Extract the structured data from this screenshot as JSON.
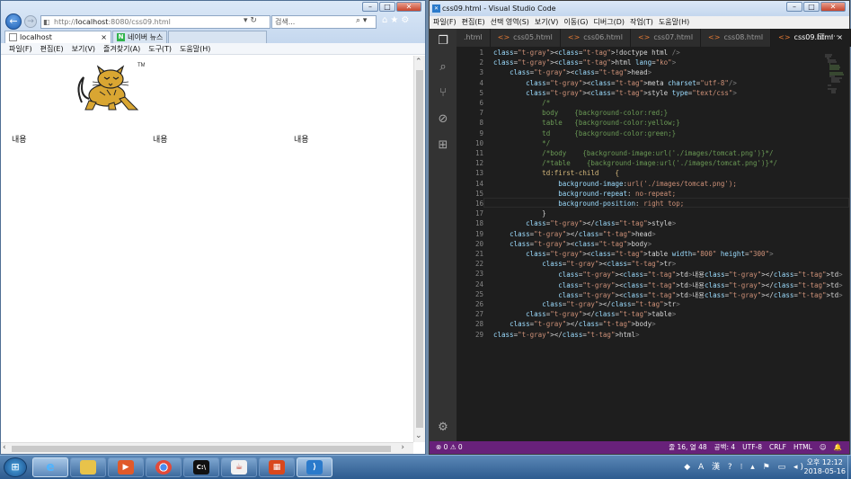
{
  "ie": {
    "address_prefix": "http://",
    "address_host": "localhost",
    "address_rest": ":8080/css09.html",
    "address_tools": "▾ ↻",
    "search_placeholder": "검색...",
    "tabs": [
      {
        "label": "localhost",
        "close": "×",
        "active": true
      },
      {
        "label": "네이버 뉴스",
        "fav": "N",
        "active": false
      }
    ],
    "menu": [
      "파일(F)",
      "편집(E)",
      "보기(V)",
      "즐겨찾기(A)",
      "도구(T)",
      "도움말(H)"
    ],
    "cells": [
      "내용",
      "내용",
      "내용"
    ],
    "logo_tm": "TM"
  },
  "vscode": {
    "title": "css09.html - Visual Studio Code",
    "menu": [
      "파일(F)",
      "편집(E)",
      "선택 영역(S)",
      "보기(V)",
      "이동(G)",
      "디버그(D)",
      "작업(T)",
      "도움말(H)"
    ],
    "tabs": [
      {
        "label": ".html",
        "dirty": false,
        "active": false
      },
      {
        "label": "css05.html",
        "dirty": true,
        "active": false
      },
      {
        "label": "css06.html",
        "dirty": true,
        "active": false
      },
      {
        "label": "css07.html",
        "dirty": true,
        "active": false
      },
      {
        "label": "css08.html",
        "dirty": true,
        "active": false
      },
      {
        "label": "css09.html",
        "dirty": true,
        "active": true
      }
    ],
    "code_lines": [
      "<!doctype html />",
      "<html lang=\"ko\">",
      "    <head>",
      "        <meta charset=\"utf-8\"/>",
      "        <style type=\"text/css\">",
      "            /*",
      "            body    {background-color:red;}",
      "            table   {background-color:yellow;}",
      "            td      {background-color:green;}",
      "            */",
      "            /*body    {background-image:url('./images/tomcat.png')}*/",
      "            /*table    {background-image:url('./images/tomcat.png')}*/",
      "            td:first-child    {",
      "                background-image:url('./images/tomcat.png');",
      "                background-repeat: no-repeat;",
      "                background-position: right top;",
      "            }",
      "        </style>",
      "    </head>",
      "    <body>",
      "        <table width=\"800\" height=\"300\">",
      "            <tr>",
      "                <td>내용</td>",
      "                <td>내용</td>",
      "                <td>내용</td>",
      "            </tr>",
      "        </table>",
      "    </body>",
      "</html>"
    ],
    "status_left": "⊗ 0 ⚠ 0",
    "status_right": [
      "줄 16, 열 48",
      "공백: 4",
      "UTF-8",
      "CRLF",
      "HTML",
      "☺",
      "🔔"
    ]
  },
  "taskbar": {
    "time": "오후 12:12",
    "date": "2018-05-16",
    "tray": "◆ A 漢 ? ⁝ ▴ ⚑ ▭ ◂)"
  },
  "colors": {
    "vscode_status": "#68217a",
    "vscode_bg": "#1e1e1e",
    "ie_chrome": "#c4d7ee"
  }
}
